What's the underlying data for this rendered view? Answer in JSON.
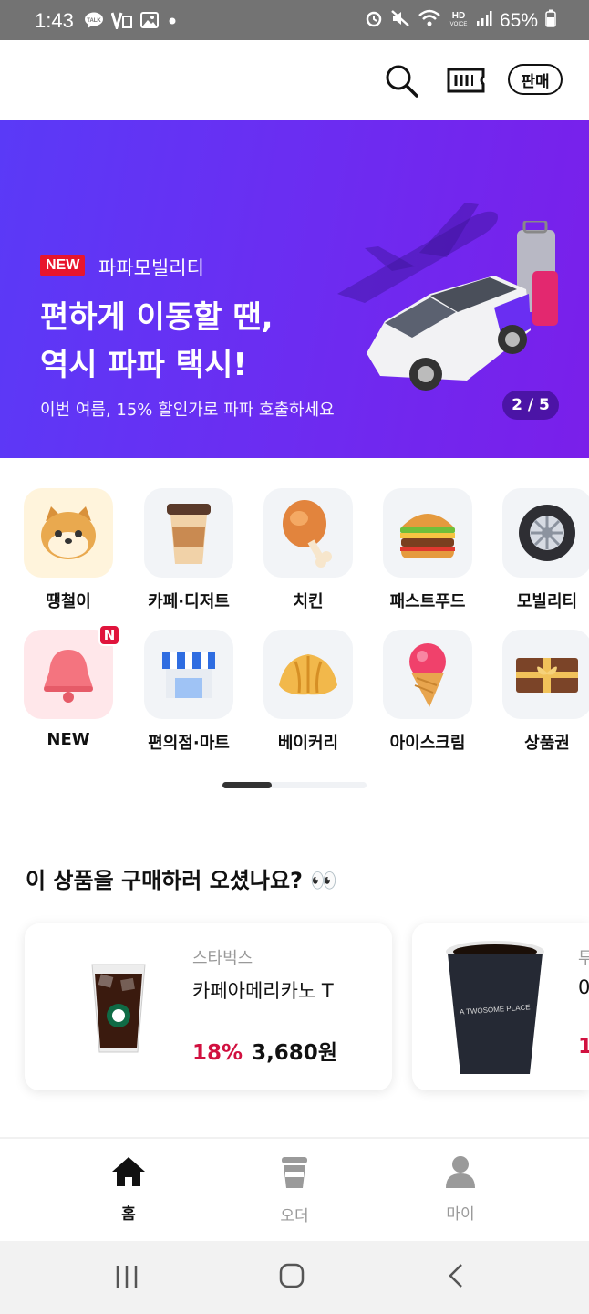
{
  "status_bar": {
    "time": "1:43",
    "battery": "65%",
    "left_icons": [
      "talk-icon",
      "v-icon",
      "gallery-icon",
      "dot-icon"
    ],
    "right_icons": [
      "alarm-icon",
      "mute-icon",
      "wifi-icon",
      "hd-voice-icon",
      "signal-icon",
      "battery-icon"
    ]
  },
  "header": {
    "sell_label": "판매",
    "icons": [
      "search-icon",
      "ticket-icon"
    ]
  },
  "banner": {
    "badge": "NEW",
    "brand": "파파모빌리티",
    "headline_line1": "편하게 이동할 땐,",
    "headline_line2": "역시 파파 택시!",
    "subtext": "이번 여름, 15% 할인가로 파파 호출하세요",
    "pager": "2 / 5",
    "colors": {
      "start": "#5a3af7",
      "end": "#7a1fea"
    }
  },
  "categories": [
    {
      "label": "땡철이",
      "icon": "hamster-face-icon"
    },
    {
      "label": "카페·디저트",
      "icon": "coffee-cup-icon"
    },
    {
      "label": "치킨",
      "icon": "chicken-leg-icon"
    },
    {
      "label": "패스트푸드",
      "icon": "burger-icon"
    },
    {
      "label": "모빌리티",
      "icon": "tire-icon"
    },
    {
      "label": "NEW",
      "icon": "bell-icon",
      "badge": "N"
    },
    {
      "label": "편의점·마트",
      "icon": "store-icon"
    },
    {
      "label": "베이커리",
      "icon": "croissant-icon"
    },
    {
      "label": "아이스크림",
      "icon": "ice-cream-icon"
    },
    {
      "label": "상품권",
      "icon": "gift-box-icon"
    }
  ],
  "recommend": {
    "title": "이 상품을 구매하러 오셨나요? 👀",
    "items": [
      {
        "store": "스타벅스",
        "name": "카페아메리카노 T",
        "discount": "18%",
        "price": "3,680원"
      },
      {
        "store": "투",
        "name": "0",
        "discount": "1",
        "price": ""
      }
    ]
  },
  "bottom_nav": [
    {
      "label": "홈",
      "icon": "home-icon",
      "active": true
    },
    {
      "label": "오더",
      "icon": "cup-icon",
      "active": false
    },
    {
      "label": "마이",
      "icon": "person-icon",
      "active": false
    }
  ],
  "accent_color": "#d1103f"
}
